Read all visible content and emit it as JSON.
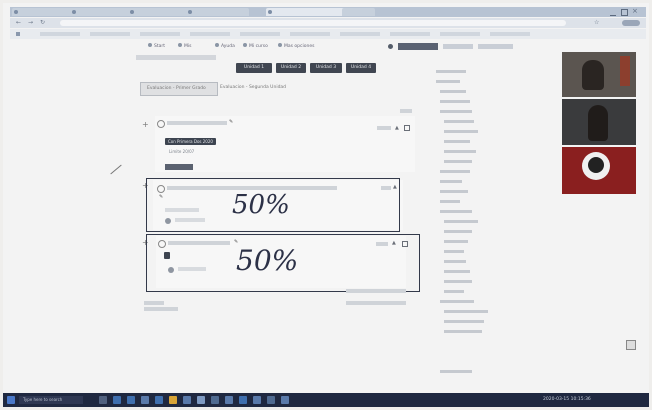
{
  "browser": {
    "tabs": [
      "",
      "",
      "",
      "",
      "",
      "",
      ""
    ],
    "url": ""
  },
  "course": {
    "nav_links": [
      "Start",
      "Mis",
      "Ayuda",
      "Mi curso",
      "Mas opciones"
    ],
    "section_buttons": [
      "Unidad 1",
      "Unidad 2",
      "Unidad 3",
      "Unidad 4",
      "Unidad 5"
    ],
    "subtabs": [
      "Evaluacion - Primer Grado",
      "Evaluacion - Segunda Unidad"
    ],
    "activities": [
      {
        "badge": "Con Primera Dos 2020",
        "note": "Limite 20/07",
        "status": ""
      },
      {
        "badge": "",
        "note": "",
        "status": ""
      },
      {
        "badge": "",
        "note": "",
        "status": ""
      }
    ],
    "handwritten_1": "50%",
    "handwritten_2": "50%"
  },
  "sidebar": {
    "items": [
      "",
      "",
      "",
      "",
      "",
      "",
      "",
      "",
      "",
      "",
      "",
      "",
      "",
      "",
      "",
      "",
      "",
      "",
      "",
      "",
      "",
      "",
      "",
      "",
      "",
      "",
      "",
      ""
    ]
  },
  "taskbar": {
    "search_placeholder": "Type here to search",
    "clock": "2020-03-15 10:15:36"
  },
  "colors": {
    "dark_button": "#404651",
    "taskbar": "#1f2840",
    "ink": "#2c3147"
  }
}
